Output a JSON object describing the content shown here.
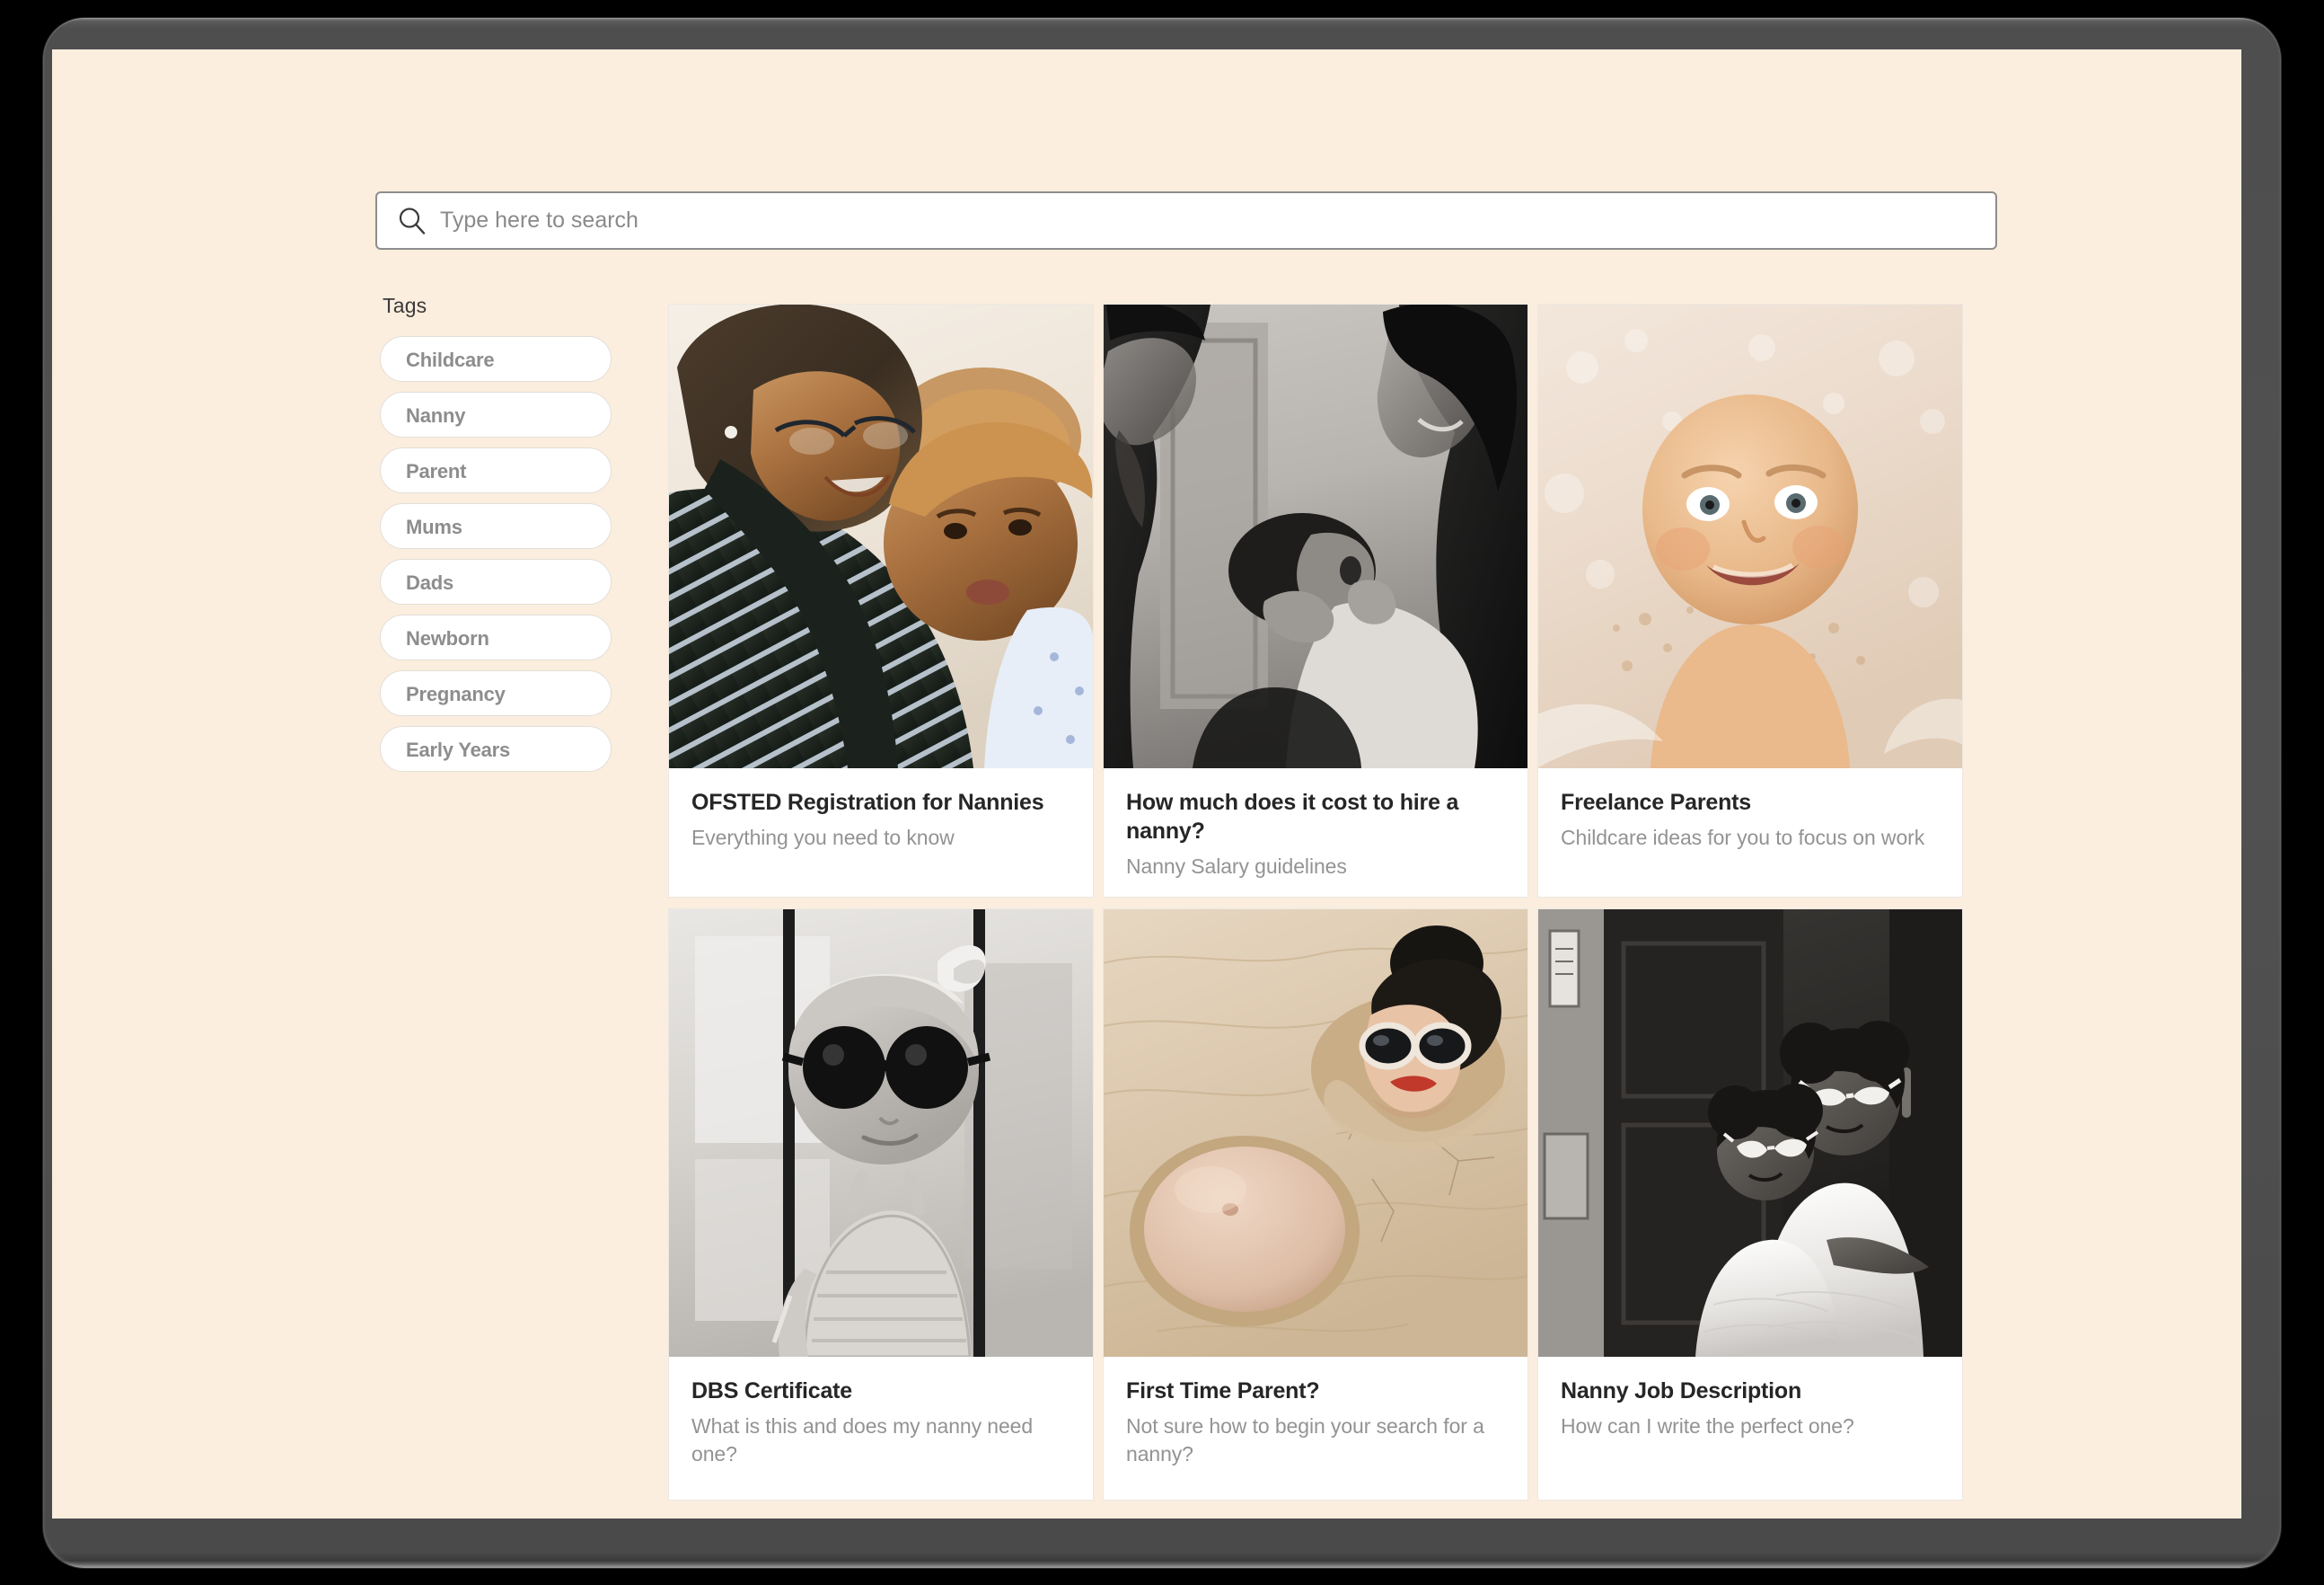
{
  "device": {
    "type": "tablet-frame",
    "bezel_color": "#4e4e4e",
    "screen_bg": "#fbeede"
  },
  "search": {
    "icon": "search-icon",
    "placeholder": "Type here to search",
    "value": ""
  },
  "sidebar": {
    "heading": "Tags",
    "tags": [
      {
        "label": "Childcare"
      },
      {
        "label": "Nanny"
      },
      {
        "label": "Parent"
      },
      {
        "label": "Mums"
      },
      {
        "label": "Dads"
      },
      {
        "label": "Newborn"
      },
      {
        "label": "Pregnancy"
      },
      {
        "label": "Early Years"
      }
    ]
  },
  "cards": [
    {
      "title": "OFSTED Registration for Nannies",
      "subtitle": "Everything you need to know",
      "image": "mother-holding-baby-warm-photo",
      "image_tone": "warm-color"
    },
    {
      "title": "How much does it cost to hire a nanny?",
      "subtitle": "Nanny Salary guidelines",
      "image": "parents-lifting-baby-photo",
      "image_tone": "black-and-white"
    },
    {
      "title": "Freelance Parents",
      "subtitle": "Childcare ideas for you to focus on work",
      "image": "smiling-baby-in-bubble-bath-photo",
      "image_tone": "warm-color"
    },
    {
      "title": "DBS Certificate",
      "subtitle": "What is this and does my nanny need one?",
      "image": "toddler-in-sunglasses-on-swing-photo",
      "image_tone": "black-and-white"
    },
    {
      "title": "First Time Parent?",
      "subtitle": "Not sure how to begin your search for a nanny?",
      "image": "pregnant-woman-buried-in-sand-photo",
      "image_tone": "warm-color"
    },
    {
      "title": "Nanny Job Description",
      "subtitle": "How can I write the perfect one?",
      "image": "two-girls-in-sunglasses-photo",
      "image_tone": "black-and-white"
    }
  ],
  "colors": {
    "page_background": "#fbeede",
    "card_background": "#ffffff",
    "title_text": "#262626",
    "subtitle_text": "#939393",
    "tag_text": "#8d8d8d",
    "search_border": "#8d8d8d"
  }
}
